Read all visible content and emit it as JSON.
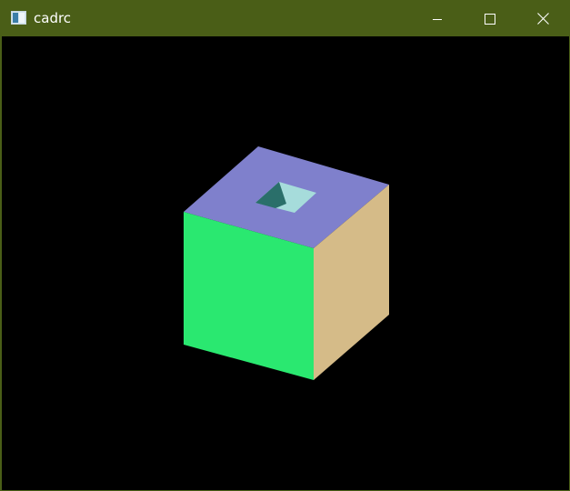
{
  "window": {
    "title": "cadrc",
    "app_icon": "window-app-icon",
    "controls": [
      "minimize-icon",
      "maximize-icon",
      "close-icon"
    ]
  },
  "scene": {
    "object": "cube-with-square-hole",
    "background_color": "#000000",
    "face_colors": {
      "top": "#7f80cc",
      "front": "#2ae870",
      "right": "#d5bb88",
      "hole_inner_dark": "#2a6f6a",
      "hole_inner_light": "#a6dcdb"
    }
  },
  "colors": {
    "titlebar": "#4a5e17",
    "title_text": "#ffffff"
  }
}
